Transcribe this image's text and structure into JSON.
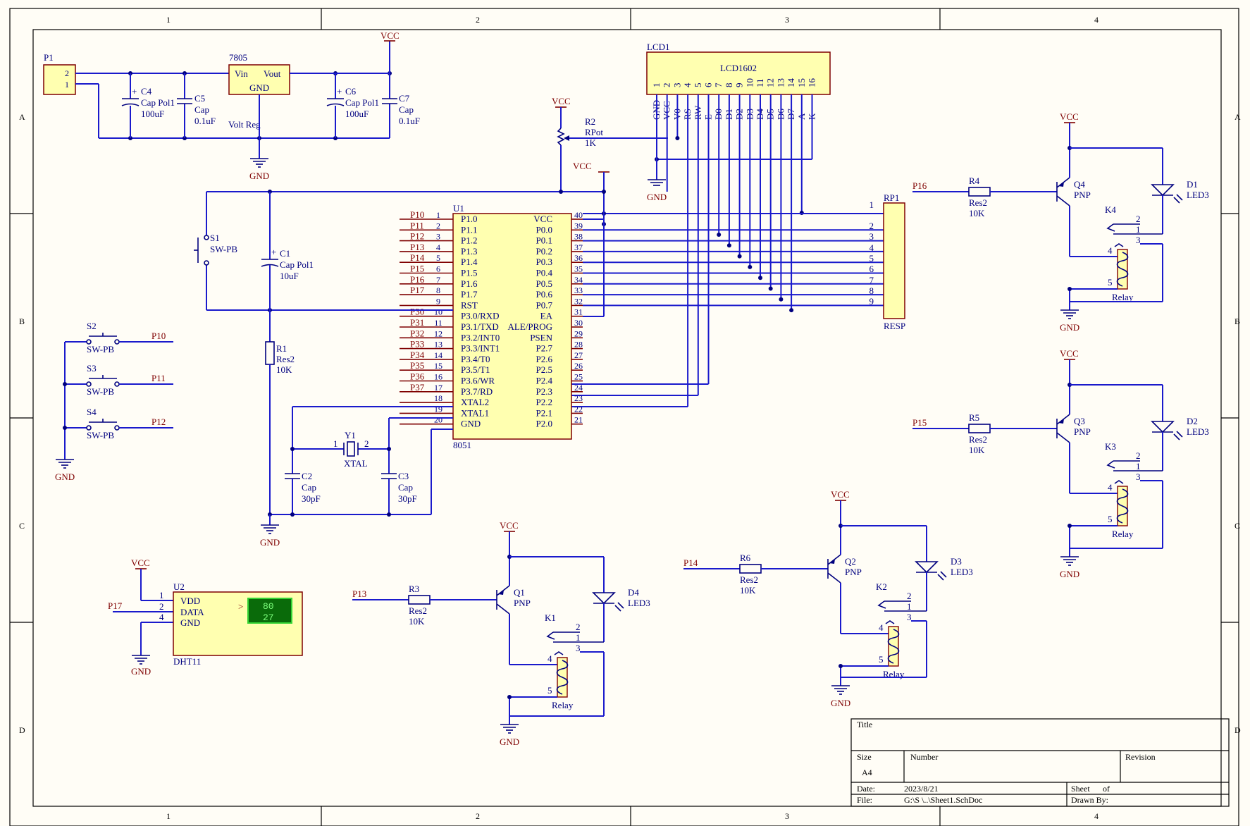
{
  "border": {
    "cols": [
      "1",
      "2",
      "3",
      "4"
    ],
    "rows": [
      "A",
      "B",
      "C",
      "D"
    ]
  },
  "power_section": {
    "p1": {
      "ref": "P1",
      "pins": [
        "2",
        "1"
      ]
    },
    "c4": {
      "ref": "C4",
      "type": "Cap Pol1",
      "value": "100uF"
    },
    "c5": {
      "ref": "C5",
      "type": "Cap",
      "value": "0.1uF"
    },
    "reg": {
      "ref": "7805",
      "vin": "Vin",
      "vout": "Vout",
      "gnd": "GND",
      "name": "Volt Reg"
    },
    "c6": {
      "ref": "C6",
      "type": "Cap Pol1",
      "value": "100uF"
    },
    "c7": {
      "ref": "C7",
      "type": "Cap",
      "value": "0.1uF"
    },
    "vcc": "VCC",
    "gnd": "GND"
  },
  "lcd": {
    "ref": "LCD1",
    "name": "LCD1602",
    "pin_numbers": [
      "1",
      "2",
      "3",
      "4",
      "5",
      "6",
      "7",
      "8",
      "9",
      "10",
      "11",
      "12",
      "13",
      "14",
      "15",
      "16"
    ],
    "pin_names": [
      "GND",
      "VCC",
      "V0",
      "RS",
      "RW",
      "E",
      "D0",
      "D1",
      "D2",
      "D3",
      "D4",
      "D5",
      "D6",
      "D7",
      "A",
      "K"
    ]
  },
  "r2": {
    "ref": "R2",
    "type": "RPot",
    "value": "1K"
  },
  "mcu": {
    "ref": "U1",
    "part": "8051",
    "left_pins": [
      {
        "num": "1",
        "name": "P1.0",
        "net": "P10"
      },
      {
        "num": "2",
        "name": "P1.1",
        "net": "P11"
      },
      {
        "num": "3",
        "name": "P1.2",
        "net": "P12"
      },
      {
        "num": "4",
        "name": "P1.3",
        "net": "P13"
      },
      {
        "num": "5",
        "name": "P1.4",
        "net": "P14"
      },
      {
        "num": "6",
        "name": "P1.5",
        "net": "P15"
      },
      {
        "num": "7",
        "name": "P1.6",
        "net": "P16"
      },
      {
        "num": "8",
        "name": "P1.7",
        "net": "P17"
      },
      {
        "num": "9",
        "name": "RST",
        "net": ""
      },
      {
        "num": "10",
        "name": "P3.0/RXD",
        "net": "P30"
      },
      {
        "num": "11",
        "name": "P3.1/TXD",
        "net": "P31"
      },
      {
        "num": "12",
        "name": "P3.2/INT0",
        "net": "P32"
      },
      {
        "num": "13",
        "name": "P3.3/INT1",
        "net": "P33"
      },
      {
        "num": "14",
        "name": "P3.4/T0",
        "net": "P34"
      },
      {
        "num": "15",
        "name": "P3.5/T1",
        "net": "P35"
      },
      {
        "num": "16",
        "name": "P3.6/WR",
        "net": "P36"
      },
      {
        "num": "17",
        "name": "P3.7/RD",
        "net": "P37"
      },
      {
        "num": "18",
        "name": "XTAL2",
        "net": ""
      },
      {
        "num": "19",
        "name": "XTAL1",
        "net": ""
      },
      {
        "num": "20",
        "name": "GND",
        "net": ""
      }
    ],
    "right_pins": [
      {
        "num": "40",
        "name": "VCC"
      },
      {
        "num": "39",
        "name": "P0.0"
      },
      {
        "num": "38",
        "name": "P0.1"
      },
      {
        "num": "37",
        "name": "P0.2"
      },
      {
        "num": "36",
        "name": "P0.3"
      },
      {
        "num": "35",
        "name": "P0.4"
      },
      {
        "num": "34",
        "name": "P0.5"
      },
      {
        "num": "33",
        "name": "P0.6"
      },
      {
        "num": "32",
        "name": "P0.7"
      },
      {
        "num": "31",
        "name": "EA"
      },
      {
        "num": "30",
        "name": "ALE/PROG"
      },
      {
        "num": "29",
        "name": "PSEN"
      },
      {
        "num": "28",
        "name": "P2.7"
      },
      {
        "num": "27",
        "name": "P2.6"
      },
      {
        "num": "26",
        "name": "P2.5"
      },
      {
        "num": "25",
        "name": "P2.4"
      },
      {
        "num": "24",
        "name": "P2.3"
      },
      {
        "num": "23",
        "name": "P2.2"
      },
      {
        "num": "22",
        "name": "P2.1"
      },
      {
        "num": "21",
        "name": "P2.0"
      }
    ]
  },
  "rp1": {
    "ref": "RP1",
    "name": "RESP",
    "pins": [
      "1",
      "2",
      "3",
      "4",
      "5",
      "6",
      "7",
      "8",
      "9"
    ]
  },
  "reset": {
    "s1": {
      "ref": "S1",
      "type": "SW-PB"
    },
    "c1": {
      "ref": "C1",
      "type": "Cap Pol1",
      "value": "10uF"
    },
    "r1": {
      "ref": "R1",
      "type": "Res2",
      "value": "10K"
    }
  },
  "crystal": {
    "y1": {
      "ref": "Y1",
      "type": "XTAL",
      "pin1": "1",
      "pin2": "2"
    },
    "c2": {
      "ref": "C2",
      "type": "Cap",
      "value": "30pF"
    },
    "c3": {
      "ref": "C3",
      "type": "Cap",
      "value": "30pF"
    }
  },
  "buttons": [
    {
      "ref": "S2",
      "type": "SW-PB",
      "net": "P10"
    },
    {
      "ref": "S3",
      "type": "SW-PB",
      "net": "P11"
    },
    {
      "ref": "S4",
      "type": "SW-PB",
      "net": "P12"
    }
  ],
  "dht": {
    "ref": "U2",
    "part": "DHT11",
    "pins": [
      {
        "num": "1",
        "name": "VDD"
      },
      {
        "num": "2",
        "name": "DATA"
      },
      {
        "num": "4",
        "name": "GND"
      }
    ],
    "net": "P17",
    "display": [
      "80",
      "27"
    ],
    "marker": ">"
  },
  "relay_channels": [
    {
      "net": "P16",
      "r": "R4",
      "q": "Q4",
      "d": "D1",
      "k": "K4"
    },
    {
      "net": "P15",
      "r": "R5",
      "q": "Q3",
      "d": "D2",
      "k": "K3"
    },
    {
      "net": "P13",
      "r": "R3",
      "q": "Q1",
      "d": "D4",
      "k": "K1"
    },
    {
      "net": "P14",
      "r": "R6",
      "q": "Q2",
      "d": "D3",
      "k": "K2"
    }
  ],
  "common": {
    "res_type": "Res2",
    "res_value": "10K",
    "pnp": "PNP",
    "led": "LED3",
    "relay": "Relay",
    "vcc": "VCC",
    "gnd": "GND"
  },
  "title_block": {
    "title": "Title",
    "size_label": "Size",
    "size_value": "A4",
    "number_label": "Number",
    "revision_label": "Revision",
    "date_label": "Date:",
    "date_value": "2023/8/21",
    "sheet_label": "Sheet",
    "of_label": "of",
    "file_label": "File:",
    "file_value": "G:\\S        \\..\\Sheet1.SchDoc",
    "drawn_label": "Drawn By:"
  }
}
